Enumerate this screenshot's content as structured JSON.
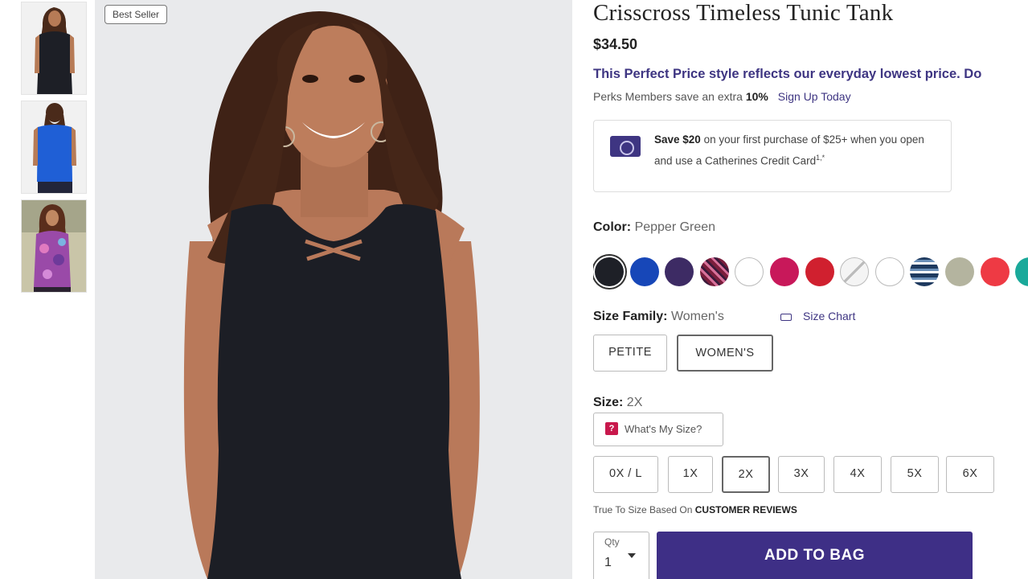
{
  "badge": "Best Seller",
  "product": {
    "title": "Crisscross Timeless Tunic Tank",
    "price": "$34.50",
    "promo": "This Perfect Price style reflects our everyday lowest price. Do",
    "perks": {
      "prefix": "Perks Members save an extra",
      "percent": "10%",
      "link": "Sign Up Today"
    },
    "credit": {
      "save": "Save $20",
      "text": "on your first purchase of $25+ when you open and use a Catherines Credit Card",
      "sup": "1,*"
    }
  },
  "color": {
    "label": "Color:",
    "value": "Pepper Green",
    "swatches": [
      {
        "name": "black",
        "color": "#1e2027"
      },
      {
        "name": "royal-blue",
        "color": "#1747b8"
      },
      {
        "name": "purple",
        "color": "#3d2b64"
      },
      {
        "name": "print",
        "color": "#7a1e3c"
      },
      {
        "name": "white",
        "color": "#ffffff"
      },
      {
        "name": "magenta",
        "color": "#c8185a"
      },
      {
        "name": "red",
        "color": "#d0202f"
      },
      {
        "name": "unavailable",
        "color": "#f2f2f2"
      },
      {
        "name": "white-2",
        "color": "#ffffff"
      },
      {
        "name": "stripe",
        "color": "#1e3a5f"
      },
      {
        "name": "sage",
        "color": "#b4b49f"
      },
      {
        "name": "coral-red",
        "color": "#ee3a44"
      },
      {
        "name": "teal",
        "color": "#1aa99a"
      }
    ]
  },
  "size_family": {
    "label": "Size Family:",
    "value": "Women's",
    "chart_link": "Size Chart",
    "options": [
      "PETITE",
      "WOMEN'S"
    ]
  },
  "size": {
    "label": "Size:",
    "value": "2X",
    "whats_my_size": "What's My Size?",
    "options": [
      "0X / L",
      "1X",
      "2X",
      "3X",
      "4X",
      "5X",
      "6X"
    ]
  },
  "fit": {
    "prefix": "True To Size Based On",
    "link": "CUSTOMER REVIEWS"
  },
  "qty": {
    "label": "Qty",
    "value": "1"
  },
  "add_to_bag": "ADD TO BAG"
}
